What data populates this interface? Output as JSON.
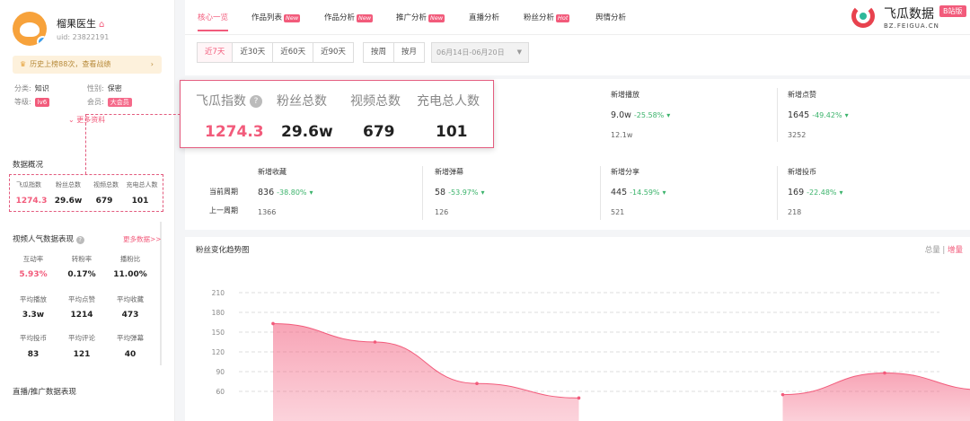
{
  "profile": {
    "name": "榴果医生",
    "uid": "uid: 23822191",
    "history_banner": "历史上榜88次，查看战绩",
    "category_label": "分类:",
    "category_value": "知识",
    "gender_label": "性别:",
    "gender_value": "保密",
    "level_label": "等级:",
    "level_value": "lv6",
    "member_label": "会员:",
    "member_value": "大会员",
    "more_info": "更多资料"
  },
  "overview": {
    "title": "数据概况",
    "items": [
      {
        "label": "飞瓜指数",
        "value": "1274.3"
      },
      {
        "label": "粉丝总数",
        "value": "29.6w"
      },
      {
        "label": "视频总数",
        "value": "679"
      },
      {
        "label": "充电总人数",
        "value": "101"
      }
    ]
  },
  "video_perf": {
    "title": "视频人气数据表现",
    "more": "更多数据>>",
    "items": [
      {
        "label": "互动率",
        "value": "5.93%"
      },
      {
        "label": "转粉率",
        "value": "0.17%"
      },
      {
        "label": "播粉比",
        "value": "11.00%"
      },
      {
        "label": "平均播放",
        "value": "3.3w"
      },
      {
        "label": "平均点赞",
        "value": "1214"
      },
      {
        "label": "平均收藏",
        "value": "473"
      },
      {
        "label": "平均投币",
        "value": "83"
      },
      {
        "label": "平均评论",
        "value": "121"
      },
      {
        "label": "平均弹幕",
        "value": "40"
      }
    ]
  },
  "live_title": "直播/推广数据表现",
  "nav": {
    "tabs": [
      {
        "label": "核心一览",
        "badge": ""
      },
      {
        "label": "作品列表",
        "badge": "New"
      },
      {
        "label": "作品分析",
        "badge": "New"
      },
      {
        "label": "推广分析",
        "badge": "New"
      },
      {
        "label": "直播分析",
        "badge": ""
      },
      {
        "label": "粉丝分析",
        "badge": "Hot"
      },
      {
        "label": "舆情分析",
        "badge": ""
      }
    ]
  },
  "logo": {
    "name": "飞瓜数据",
    "badge": "B站版",
    "url": "BZ.FEIGUA.CN"
  },
  "filters": {
    "ranges": [
      "近7天",
      "近30天",
      "近60天",
      "近90天"
    ],
    "periods": [
      "按周",
      "按月"
    ],
    "date_range": "06月14日-06月20日"
  },
  "stats": {
    "current_label": "当前周期",
    "previous_label": "上一周期",
    "top": [
      {
        "label": "新增播放",
        "value": "9.0w",
        "change": "-25.58%",
        "prev": "12.1w"
      },
      {
        "label": "新增点赞",
        "value": "1645",
        "change": "-49.42%",
        "prev": "3252"
      }
    ],
    "bottom": [
      {
        "label": "新增收藏",
        "value": "836",
        "change": "-38.80%",
        "prev": "1366"
      },
      {
        "label": "新增弹幕",
        "value": "58",
        "change": "-53.97%",
        "prev": "126"
      },
      {
        "label": "新增分享",
        "value": "445",
        "change": "-14.59%",
        "prev": "521"
      },
      {
        "label": "新增投币",
        "value": "169",
        "change": "-22.48%",
        "prev": "218"
      }
    ]
  },
  "highlight": {
    "items": [
      {
        "label": "飞瓜指数",
        "value": "1274.3"
      },
      {
        "label": "粉丝总数",
        "value": "29.6w"
      },
      {
        "label": "视频总数",
        "value": "679"
      },
      {
        "label": "充电总人数",
        "value": "101"
      }
    ]
  },
  "chart_meta": {
    "title": "粉丝变化趋势图",
    "toggle_total": "总量",
    "toggle_increment": "增量",
    "separator": "|"
  },
  "chart_data": {
    "type": "area",
    "title": "粉丝变化趋势图",
    "y_ticks": [
      210,
      180,
      150,
      120,
      90,
      60
    ],
    "ylim": [
      60,
      210
    ],
    "series": [
      {
        "x": [
          0,
          1,
          2,
          3
        ],
        "values": [
          163,
          135,
          72,
          50
        ]
      },
      {
        "x": [
          5,
          6,
          7
        ],
        "values": [
          55,
          88,
          62
        ]
      }
    ],
    "color": "#f25b7b"
  }
}
